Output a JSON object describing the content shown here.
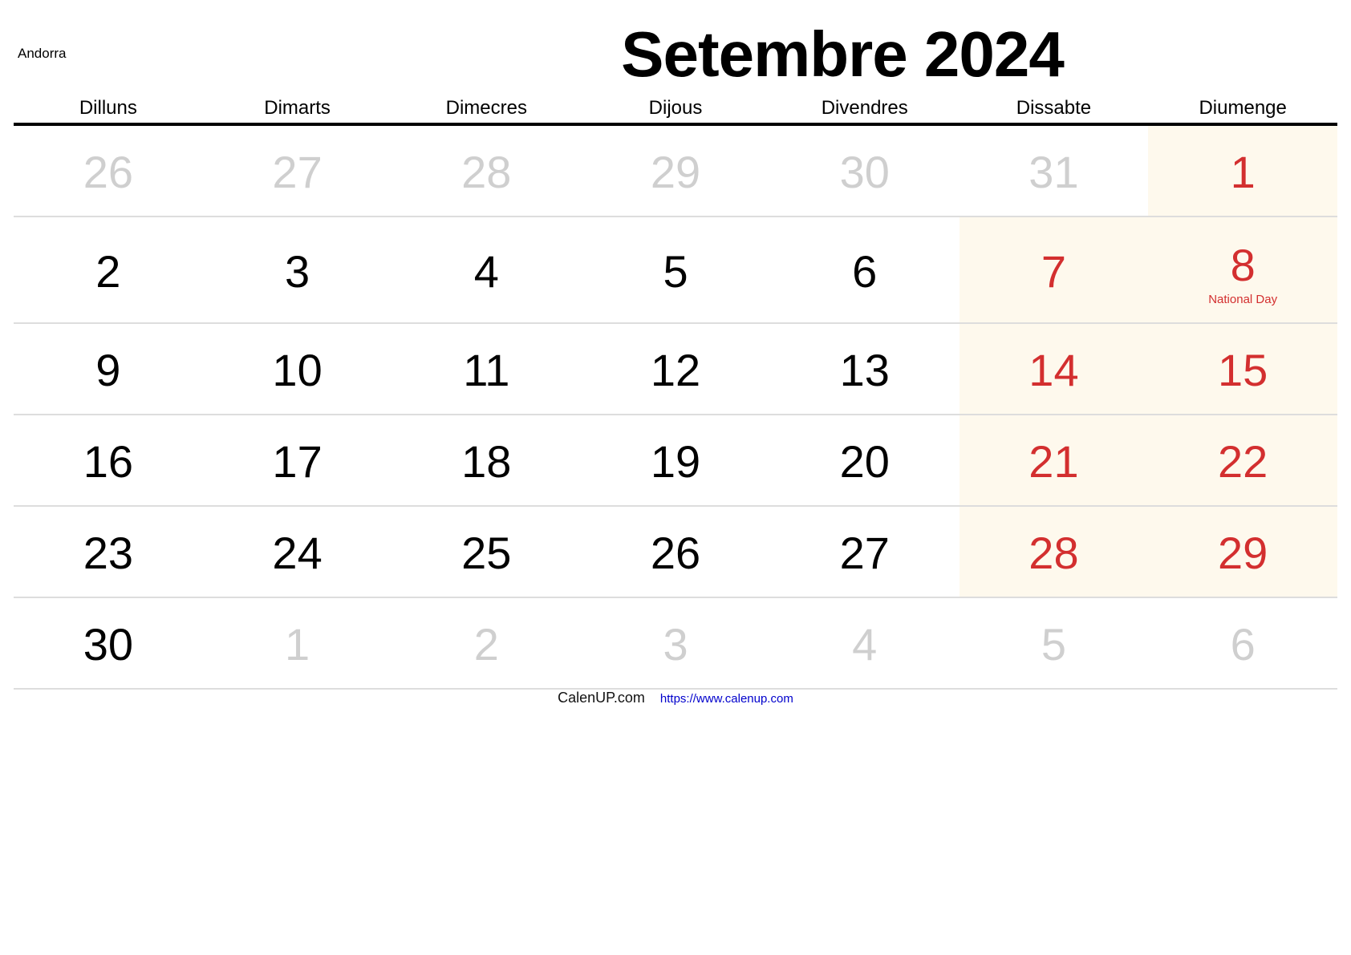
{
  "header": {
    "country": "Andorra",
    "title": "Setembre 2024"
  },
  "weekdays": [
    "Dilluns",
    "Dimarts",
    "Dimecres",
    "Dijous",
    "Divendres",
    "Dissabte",
    "Diumenge"
  ],
  "weeks": [
    [
      {
        "day": "26",
        "type": "muted"
      },
      {
        "day": "27",
        "type": "muted"
      },
      {
        "day": "28",
        "type": "muted"
      },
      {
        "day": "29",
        "type": "muted"
      },
      {
        "day": "30",
        "type": "muted"
      },
      {
        "day": "31",
        "type": "muted"
      },
      {
        "day": "1",
        "type": "weekend"
      }
    ],
    [
      {
        "day": "2",
        "type": "normal"
      },
      {
        "day": "3",
        "type": "normal"
      },
      {
        "day": "4",
        "type": "normal"
      },
      {
        "day": "5",
        "type": "normal"
      },
      {
        "day": "6",
        "type": "normal"
      },
      {
        "day": "7",
        "type": "weekend"
      },
      {
        "day": "8",
        "type": "weekend",
        "holiday": "National Day"
      }
    ],
    [
      {
        "day": "9",
        "type": "normal"
      },
      {
        "day": "10",
        "type": "normal"
      },
      {
        "day": "11",
        "type": "normal"
      },
      {
        "day": "12",
        "type": "normal"
      },
      {
        "day": "13",
        "type": "normal"
      },
      {
        "day": "14",
        "type": "weekend"
      },
      {
        "day": "15",
        "type": "weekend"
      }
    ],
    [
      {
        "day": "16",
        "type": "normal"
      },
      {
        "day": "17",
        "type": "normal"
      },
      {
        "day": "18",
        "type": "normal"
      },
      {
        "day": "19",
        "type": "normal"
      },
      {
        "day": "20",
        "type": "normal"
      },
      {
        "day": "21",
        "type": "weekend"
      },
      {
        "day": "22",
        "type": "weekend"
      }
    ],
    [
      {
        "day": "23",
        "type": "normal"
      },
      {
        "day": "24",
        "type": "normal"
      },
      {
        "day": "25",
        "type": "normal"
      },
      {
        "day": "26",
        "type": "normal"
      },
      {
        "day": "27",
        "type": "normal"
      },
      {
        "day": "28",
        "type": "weekend"
      },
      {
        "day": "29",
        "type": "weekend"
      }
    ],
    [
      {
        "day": "30",
        "type": "normal"
      },
      {
        "day": "1",
        "type": "muted"
      },
      {
        "day": "2",
        "type": "muted"
      },
      {
        "day": "3",
        "type": "muted"
      },
      {
        "day": "4",
        "type": "muted"
      },
      {
        "day": "5",
        "type": "muted"
      },
      {
        "day": "6",
        "type": "muted"
      }
    ]
  ],
  "footer": {
    "brand": "CalenUP.com",
    "link": "https://www.calenup.com"
  },
  "colors": {
    "weekend_text": "#d32f2f",
    "weekend_bg": "#fef9ed",
    "muted_text": "#cfcfcf",
    "link": "#0000cc"
  }
}
